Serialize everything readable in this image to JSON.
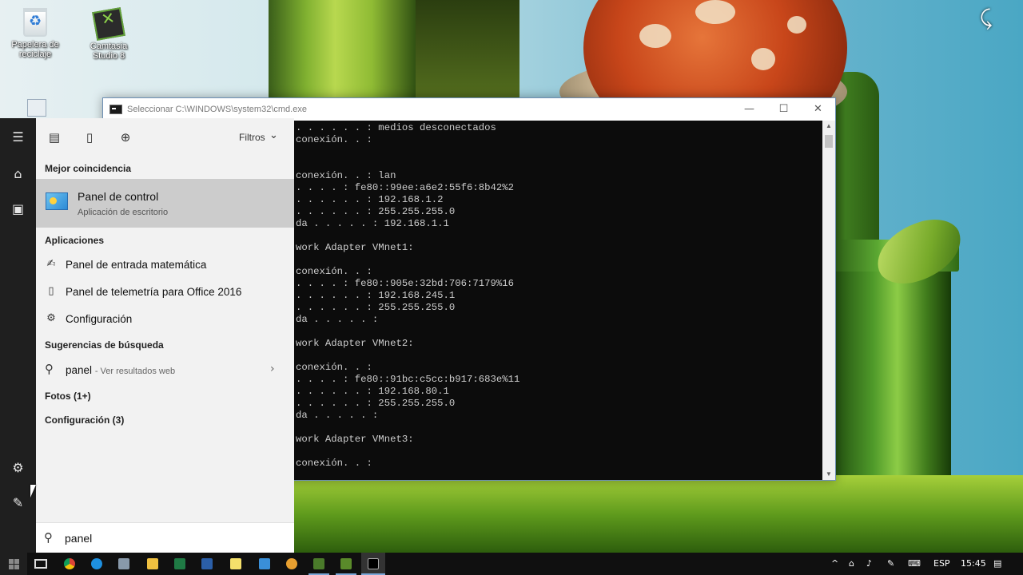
{
  "desktop": {
    "icons": [
      {
        "label": "Papelera de reciclaje",
        "icon": "recycle-bin-icon"
      },
      {
        "label": "Camtasia Studio 8",
        "icon": "camtasia-icon"
      }
    ]
  },
  "cmd": {
    "title": "Seleccionar C:\\WINDOWS\\system32\\cmd.exe",
    "controls": {
      "minimize": "—",
      "maximize": "☐",
      "close": "✕"
    },
    "lines": [
      ". . . . . . : medios desconectados",
      "conexión. . :",
      "",
      "",
      "conexión. . : lan",
      ". . . . : fe80::99ee:a6e2:55f6:8b42%2",
      ". . . . . . : 192.168.1.2",
      ". . . . . . : 255.255.255.0",
      "da . . . . . : 192.168.1.1",
      "",
      "work Adapter VMnet1:",
      "",
      "conexión. . :",
      ". . . . : fe80::905e:32bd:706:7179%16",
      ". . . . . . : 192.168.245.1",
      ". . . . . . : 255.255.255.0",
      "da . . . . . :",
      "",
      "work Adapter VMnet2:",
      "",
      "conexión. . :",
      ". . . . : fe80::91bc:c5cc:b917:683e%11",
      ". . . . . . : 192.168.80.1",
      ". . . . . . : 255.255.255.0",
      "da . . . . . :",
      "",
      "work Adapter VMnet3:",
      "",
      "conexión. . :"
    ]
  },
  "start": {
    "filters_label": "Filtros",
    "best_match_header": "Mejor coincidencia",
    "best_match": {
      "name": "Panel de control",
      "subtitle": "Aplicación de escritorio"
    },
    "apps_header": "Aplicaciones",
    "apps": [
      {
        "label": "Panel de entrada matemática",
        "icon": "math-input-icon"
      },
      {
        "label": "Panel de telemetría para Office 2016",
        "icon": "document-icon"
      },
      {
        "label": "Configuración",
        "icon": "settings-icon"
      }
    ],
    "suggestions_header": "Sugerencias de búsqueda",
    "suggestion": {
      "query": "panel",
      "more": "- Ver resultados web"
    },
    "photos_header": "Fotos (1+)",
    "config_header": "Configuración (3)",
    "search_value": "panel"
  },
  "taskbar": {
    "apps": [
      "task-view",
      "chrome",
      "edge",
      "settings",
      "file-explorer",
      "excel",
      "word",
      "sticky-notes",
      "photos",
      "paint",
      "camtasia",
      "camtasia-recorder",
      "cmd"
    ],
    "language": "ESP",
    "time": "15:45"
  }
}
